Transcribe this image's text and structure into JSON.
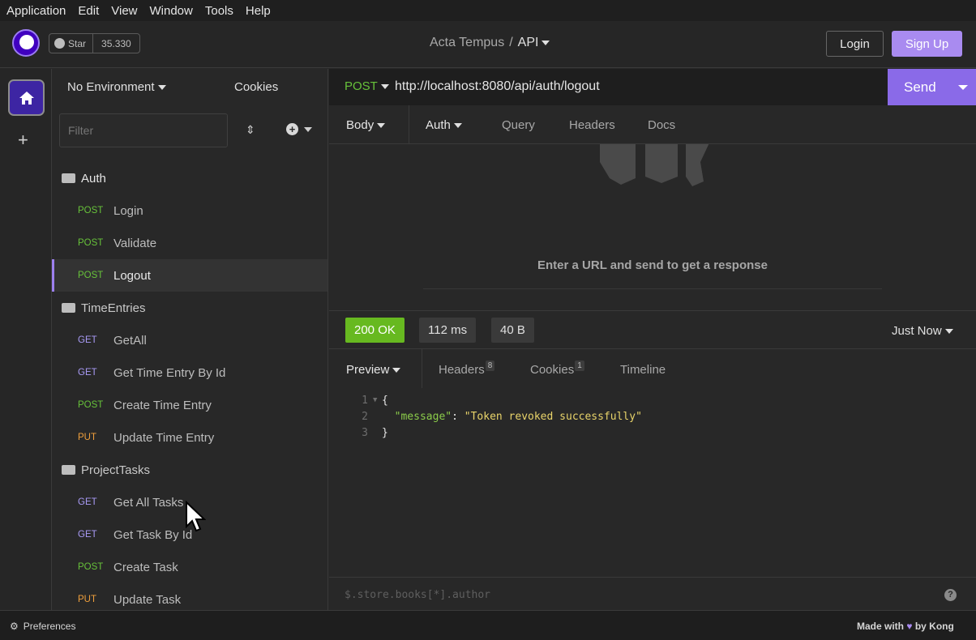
{
  "menu": [
    "Application",
    "Edit",
    "View",
    "Window",
    "Tools",
    "Help"
  ],
  "header": {
    "star_label": "Star",
    "star_count": "35.330",
    "project": "Acta Tempus",
    "separator": "/",
    "collection": "API",
    "login": "Login",
    "signup": "Sign Up"
  },
  "sidebar": {
    "environment": "No Environment",
    "cookies": "Cookies",
    "filter_placeholder": "Filter",
    "folders": [
      {
        "name": "Auth",
        "items": [
          {
            "method": "POST",
            "label": "Login"
          },
          {
            "method": "POST",
            "label": "Validate"
          },
          {
            "method": "POST",
            "label": "Logout",
            "active": true
          }
        ]
      },
      {
        "name": "TimeEntries",
        "items": [
          {
            "method": "GET",
            "label": "GetAll"
          },
          {
            "method": "GET",
            "label": "Get Time Entry By Id"
          },
          {
            "method": "POST",
            "label": "Create Time Entry"
          },
          {
            "method": "PUT",
            "label": "Update Time Entry"
          }
        ]
      },
      {
        "name": "ProjectTasks",
        "items": [
          {
            "method": "GET",
            "label": "Get All Tasks"
          },
          {
            "method": "GET",
            "label": "Get Task By Id"
          },
          {
            "method": "POST",
            "label": "Create Task"
          },
          {
            "method": "PUT",
            "label": "Update Task"
          }
        ]
      }
    ]
  },
  "request": {
    "method": "POST",
    "url": "http://localhost:8080/api/auth/logout",
    "send": "Send",
    "tabs": [
      "Body",
      "Auth",
      "Query",
      "Headers",
      "Docs"
    ],
    "empty_hint": "Enter a URL and send to get a response"
  },
  "response": {
    "status": "200 OK",
    "time": "112 ms",
    "size": "40 B",
    "when": "Just Now",
    "tabs": {
      "preview": "Preview",
      "headers": "Headers",
      "headers_count": "8",
      "cookies": "Cookies",
      "cookies_count": "1",
      "timeline": "Timeline"
    },
    "lines": [
      "{",
      "\"message\": \"Token revoked successfully\"",
      "}"
    ],
    "json_key": "\"message\"",
    "json_value": "\"Token revoked successfully\"",
    "jsonpath_placeholder": "$.store.books[*].author"
  },
  "footer": {
    "preferences": "Preferences",
    "made_with": "Made with",
    "by": "by Kong"
  },
  "colors": {
    "accent": "#8a6ae8",
    "ok": "#67b920",
    "post": "#67c23a",
    "get": "#a89af5",
    "put": "#ef9f3c"
  }
}
